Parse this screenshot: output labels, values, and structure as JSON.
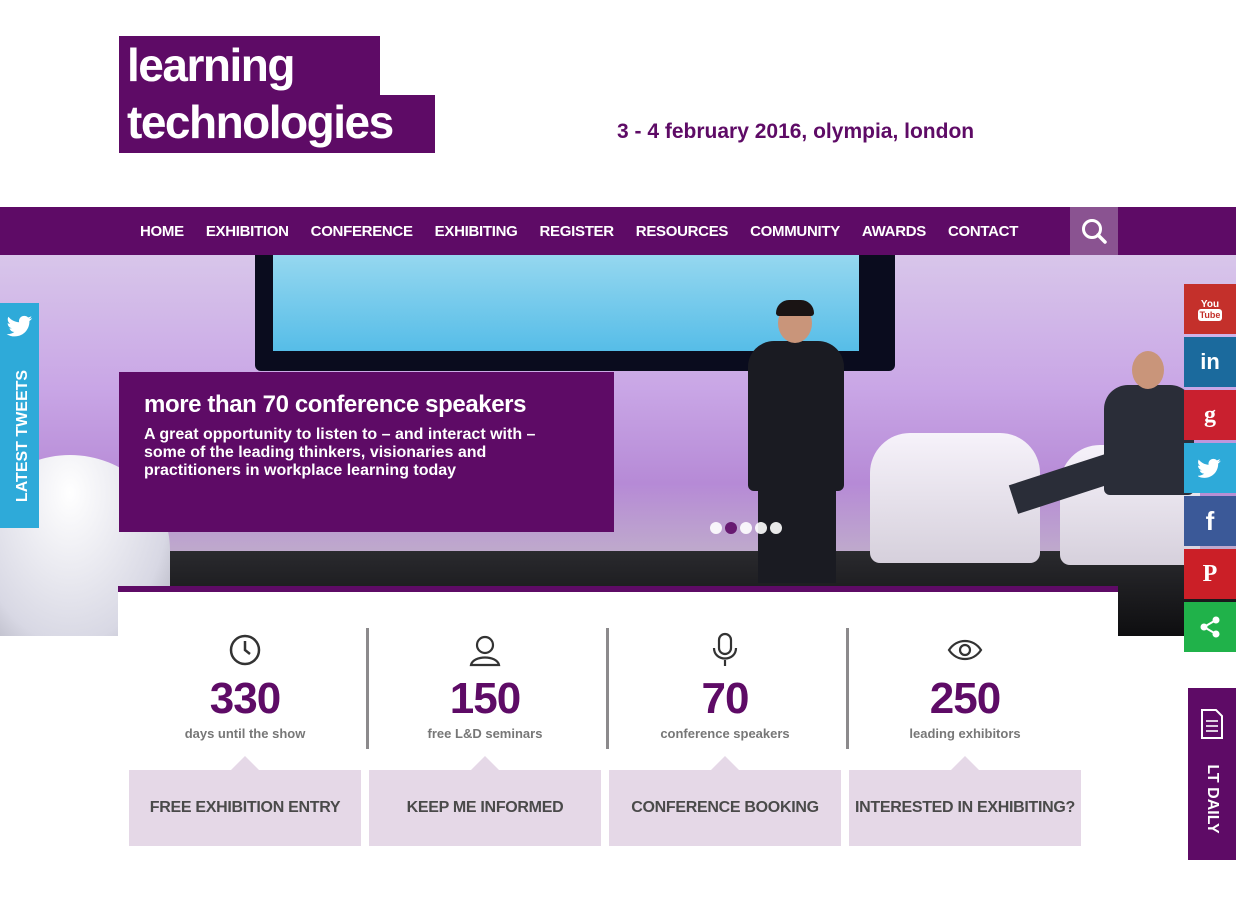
{
  "logo": {
    "line1": "learning",
    "line2": "technologies"
  },
  "event": {
    "dates": "3 - 4 february 2016, olympia, london"
  },
  "nav": {
    "items": [
      "HOME",
      "EXHIBITION",
      "CONFERENCE",
      "EXHIBITING",
      "REGISTER",
      "RESOURCES",
      "COMMUNITY",
      "AWARDS",
      "CONTACT"
    ],
    "search_icon": "search-icon"
  },
  "hero": {
    "title": "more than 70 conference speakers",
    "text": "A great opportunity to listen to – and interact with – some of the leading thinkers, visionaries and practitioners in workplace learning today",
    "slides": 5,
    "active_slide": 2
  },
  "sidebar_left": {
    "label": "LATEST TWEETS",
    "icon": "twitter-icon"
  },
  "social": [
    {
      "name": "youtube",
      "label": "You Tube",
      "color": "#c4302b"
    },
    {
      "name": "linkedin",
      "label": "in",
      "color": "#1b6a9d"
    },
    {
      "name": "googleplus",
      "label": "g",
      "color": "#c9202f"
    },
    {
      "name": "twitter",
      "label": "",
      "color": "#2eaad9"
    },
    {
      "name": "facebook",
      "label": "f",
      "color": "#3b5998"
    },
    {
      "name": "pinterest",
      "label": "P",
      "color": "#cb1f27"
    },
    {
      "name": "share",
      "label": "",
      "color": "#20b24a"
    }
  ],
  "lt_daily": {
    "label": "LT DAILY",
    "icon": "document-icon"
  },
  "stats": [
    {
      "value": "330",
      "label": "days until the show",
      "icon": "clock-icon",
      "cta": "FREE EXHIBITION ENTRY"
    },
    {
      "value": "150",
      "label": "free L&D seminars",
      "icon": "user-icon",
      "cta": "KEEP ME INFORMED"
    },
    {
      "value": "70",
      "label": "conference speakers",
      "icon": "microphone-icon",
      "cta": "CONFERENCE BOOKING"
    },
    {
      "value": "250",
      "label": "leading exhibitors",
      "icon": "eye-icon",
      "cta": "INTERESTED IN EXHIBITING?"
    }
  ],
  "colors": {
    "brand": "#5e0b66",
    "cta_bg": "#e5d8e7",
    "twitter": "#2eaad9"
  }
}
